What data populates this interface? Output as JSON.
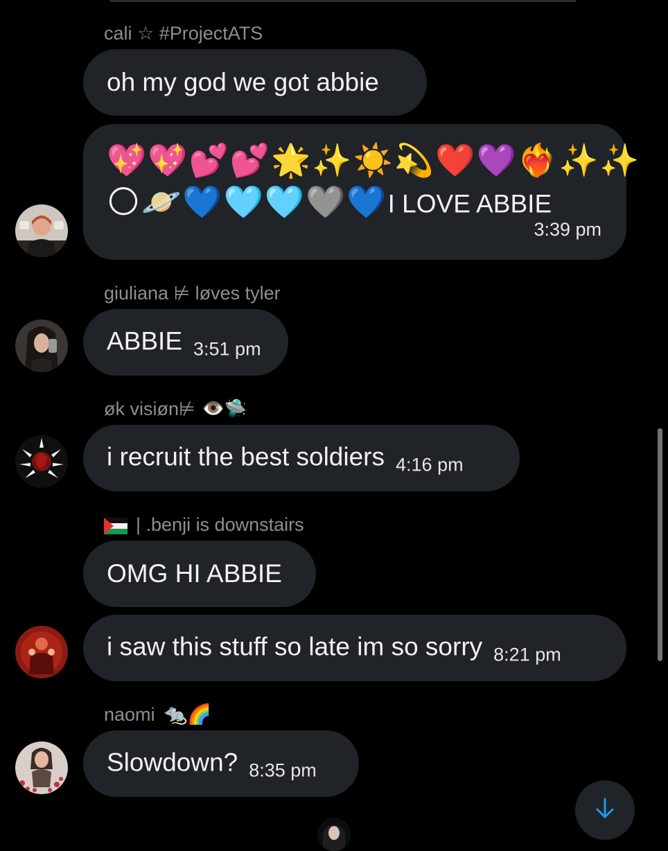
{
  "messages": [
    {
      "sender": "cali ☆ #ProjectATS",
      "text": "oh my god we got abbie",
      "time": ""
    },
    {
      "sender": "",
      "emoji_line_1": "💖💖💕💕🌟✨☀️💫❤️💜❤️‍🔥✨✨",
      "emoji_line_2": "🌕🪐💙🩵🩵🩶💙",
      "text": "I LOVE ABBIE",
      "time": "3:39 pm"
    },
    {
      "sender": "giuliana ⊭ løves tyler",
      "text": "ABBIE",
      "time": "3:51 pm"
    },
    {
      "sender": "øk visiøn⊭",
      "sender_emoji": "👁️🛸",
      "text": "i recruit the best soldiers",
      "time": "4:16 pm"
    },
    {
      "sender": "| .benji is downstairs",
      "sender_flag": "palestine-flag",
      "text": "OMG HI ABBIE",
      "time": ""
    },
    {
      "sender": "",
      "text": "i saw this stuff so late im so sorry",
      "time": "8:21 pm"
    },
    {
      "sender": "naomi",
      "sender_emoji": "🐀🌈",
      "text": "Slowdown?",
      "time": "8:35 pm"
    }
  ],
  "scroll_down_icon": "arrow-down-icon",
  "colors": {
    "background": "#000000",
    "bubble": "#202327",
    "sender_text": "#8b8f94",
    "accent_arrow": "#1d9bf0"
  }
}
